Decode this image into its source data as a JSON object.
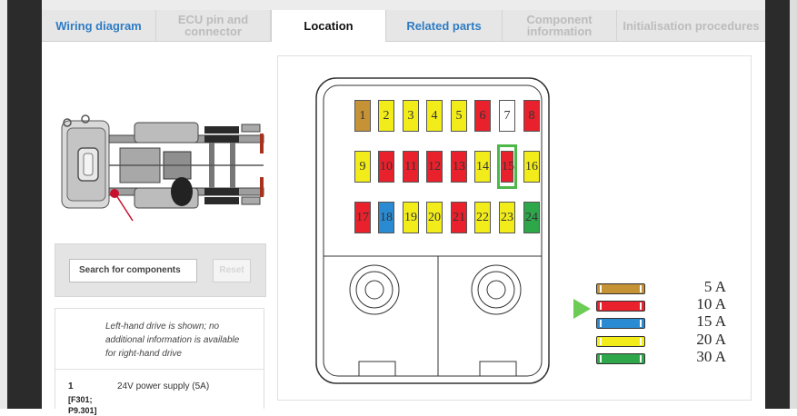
{
  "tabs": [
    {
      "label": "Wiring diagram",
      "state": "link"
    },
    {
      "label": "ECU pin and connector",
      "state": "disabled"
    },
    {
      "label": "Location",
      "state": "active"
    },
    {
      "label": "Related parts",
      "state": "link"
    },
    {
      "label": "Component information",
      "state": "disabled"
    },
    {
      "label": "Initialisation procedures",
      "state": "disabled"
    }
  ],
  "search": {
    "placeholder": "Search for components",
    "reset_label": "Reset"
  },
  "info": {
    "note": "Left-hand drive is shown; no additional information is available for right-hand drive",
    "items": [
      {
        "number": "1",
        "code": "[F301; P9.301]",
        "description": "24V power supply (5A)"
      }
    ]
  },
  "fuses": [
    {
      "label": "1",
      "color": "brown"
    },
    {
      "label": "2",
      "color": "yellow"
    },
    {
      "label": "3",
      "color": "yellow"
    },
    {
      "label": "4",
      "color": "yellow"
    },
    {
      "label": "5",
      "color": "yellow"
    },
    {
      "label": "6",
      "color": "red"
    },
    {
      "label": "7",
      "color": "white"
    },
    {
      "label": "8",
      "color": "red"
    },
    {
      "label": "9",
      "color": "yellow"
    },
    {
      "label": "10",
      "color": "red"
    },
    {
      "label": "11",
      "color": "red"
    },
    {
      "label": "12",
      "color": "red"
    },
    {
      "label": "13",
      "color": "red"
    },
    {
      "label": "14",
      "color": "yellow"
    },
    {
      "label": "15",
      "color": "red",
      "highlighted": true
    },
    {
      "label": "16",
      "color": "yellow"
    },
    {
      "label": "17",
      "color": "red"
    },
    {
      "label": "18",
      "color": "blue"
    },
    {
      "label": "19",
      "color": "yellow"
    },
    {
      "label": "20",
      "color": "yellow"
    },
    {
      "label": "21",
      "color": "red"
    },
    {
      "label": "22",
      "color": "yellow"
    },
    {
      "label": "23",
      "color": "yellow"
    },
    {
      "label": "24",
      "color": "green"
    }
  ],
  "legend": [
    {
      "label": "5 A",
      "color": "#c59236"
    },
    {
      "label": "10 A",
      "color": "#e8212c"
    },
    {
      "label": "15 A",
      "color": "#2a8bd2"
    },
    {
      "label": "20 A",
      "color": "#f2ec1b"
    },
    {
      "label": "30 A",
      "color": "#2ea64a"
    }
  ],
  "colors": {
    "tab_link": "#2f7cc4",
    "highlight": "#4cb848",
    "indicator_arrow": "#6ccc56",
    "location_marker": "#c8102e"
  }
}
